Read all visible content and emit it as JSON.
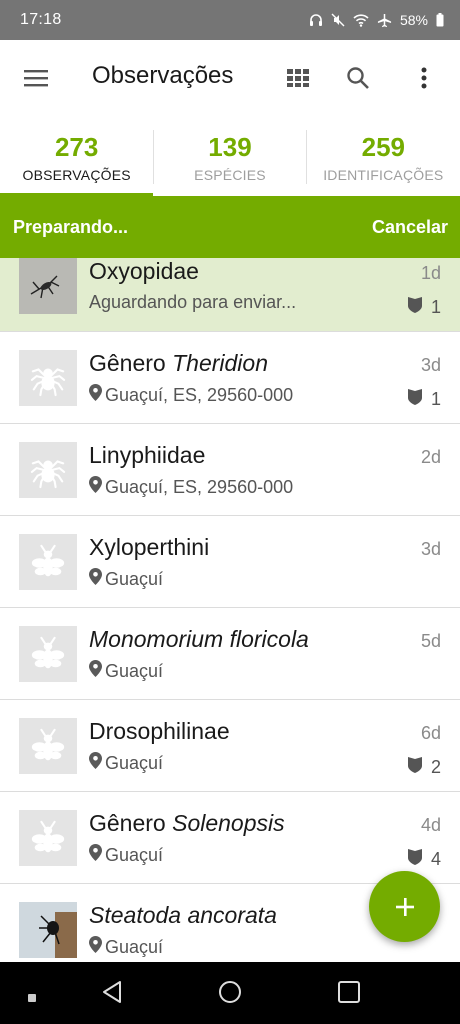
{
  "status_bar": {
    "time": "17:18",
    "battery": "58%",
    "icons": [
      "headphones-icon",
      "mute-icon",
      "wifi-icon",
      "airplane-icon",
      "battery-icon"
    ]
  },
  "app_bar": {
    "title": "Observações",
    "icons": [
      "menu-icon",
      "grid-icon",
      "search-icon",
      "more-vert-icon"
    ]
  },
  "tabs": [
    {
      "count": "273",
      "label": "OBSERVAÇÕES",
      "active": true
    },
    {
      "count": "139",
      "label": "ESPÉCIES",
      "active": false
    },
    {
      "count": "259",
      "label": "IDENTIFICAÇÕES",
      "active": false
    }
  ],
  "upload_banner": {
    "status": "Preparando...",
    "cancel": "Cancelar"
  },
  "observations": [
    {
      "prefix": "",
      "name": "Oxyopidae",
      "italic": false,
      "sub": "Aguardando para enviar...",
      "show_pin": false,
      "date": "1d",
      "ids": "1",
      "thumb": "photo-spider",
      "pending": true
    },
    {
      "prefix": "Gênero ",
      "name": "Theridion",
      "italic": true,
      "sub": "Guaçuí, ES, 29560-000",
      "show_pin": true,
      "date": "3d",
      "ids": "1",
      "thumb": "spider-icon"
    },
    {
      "prefix": "",
      "name": "Linyphiidae",
      "italic": false,
      "sub": "Guaçuí, ES, 29560-000",
      "show_pin": true,
      "date": "2d",
      "ids": "",
      "thumb": "spider-icon"
    },
    {
      "prefix": "",
      "name": "Xyloperthini",
      "italic": false,
      "sub": "Guaçuí",
      "show_pin": true,
      "date": "3d",
      "ids": "",
      "thumb": "insect-icon"
    },
    {
      "prefix": "",
      "name": "Monomorium floricola",
      "italic": true,
      "sub": "Guaçuí",
      "show_pin": true,
      "date": "5d",
      "ids": "",
      "thumb": "insect-icon"
    },
    {
      "prefix": "",
      "name": "Drosophilinae",
      "italic": false,
      "sub": "Guaçuí",
      "show_pin": true,
      "date": "6d",
      "ids": "2",
      "thumb": "insect-icon"
    },
    {
      "prefix": "Gênero ",
      "name": "Solenopsis",
      "italic": true,
      "sub": "Guaçuí",
      "show_pin": true,
      "date": "4d",
      "ids": "4",
      "thumb": "insect-icon"
    },
    {
      "prefix": "",
      "name": "Steatoda ancorata",
      "italic": true,
      "sub": "Guaçuí",
      "show_pin": true,
      "date": "",
      "ids": "",
      "thumb": "photo-spider-2"
    }
  ],
  "fab": {
    "icon": "plus-icon"
  },
  "nav_bar": {
    "icons": [
      "nav-dot-icon",
      "back-icon",
      "home-icon",
      "recents-icon"
    ]
  },
  "colors": {
    "accent": "#74ac00",
    "pending_bg": "#e2edcf",
    "status_bar": "#757575"
  }
}
